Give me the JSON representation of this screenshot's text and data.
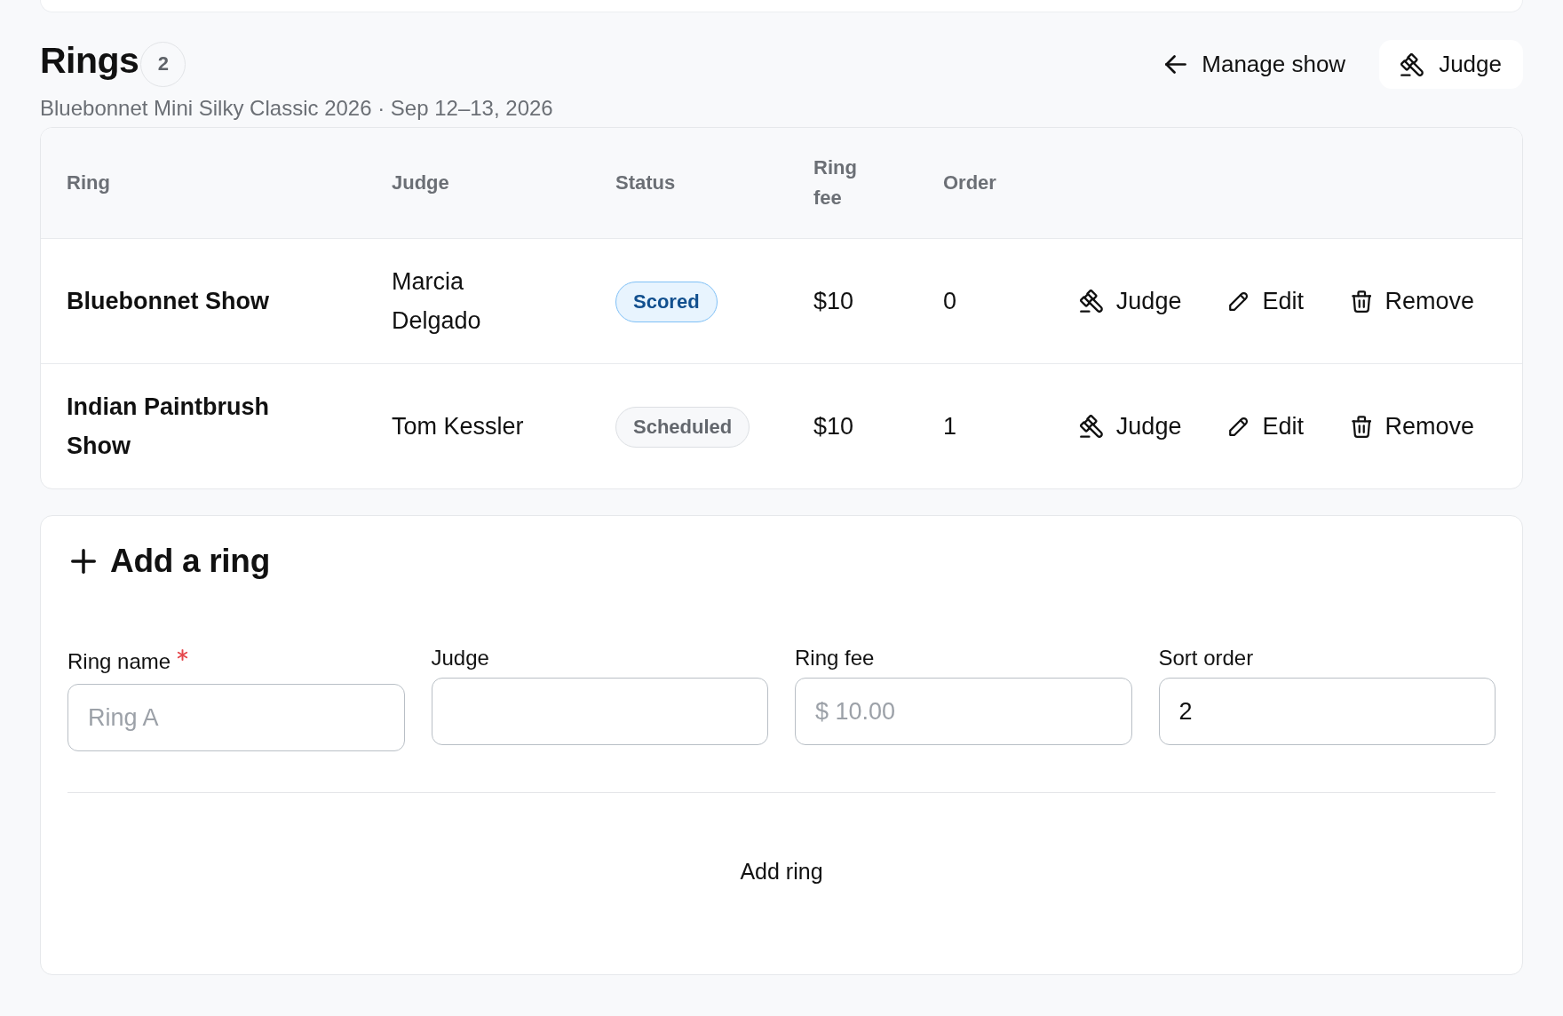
{
  "header": {
    "title": "Rings",
    "count": "2",
    "subtitle": "Bluebonnet Mini Silky Classic 2026 · Sep 12–13, 2026",
    "actions": [
      {
        "kind": "back",
        "label": "Manage show"
      },
      {
        "kind": "judge",
        "label": "Judge"
      }
    ]
  },
  "table": {
    "columns": [
      "Ring",
      "Judge",
      "Status",
      "Ring fee",
      "Order"
    ],
    "rows": [
      {
        "ring": "Bluebonnet Show",
        "judge": "Marcia Delgado",
        "status": {
          "kind": "scored",
          "label": "Scored"
        },
        "ring_fee": "$10",
        "order": "0",
        "actions": [
          {
            "kind": "judge",
            "label": "Judge"
          },
          {
            "kind": "edit",
            "label": "Edit"
          },
          {
            "kind": "remove",
            "label": "Remove"
          }
        ]
      },
      {
        "ring": "Indian Paintbrush Show",
        "judge": "Tom Kessler",
        "status": {
          "kind": "scheduled",
          "label": "Scheduled"
        },
        "ring_fee": "$10",
        "order": "1",
        "actions": [
          {
            "kind": "judge",
            "label": "Judge"
          },
          {
            "kind": "edit",
            "label": "Edit"
          },
          {
            "kind": "remove",
            "label": "Remove"
          }
        ]
      }
    ]
  },
  "add_ring": {
    "title": "Add a ring",
    "fields": [
      {
        "label": "Ring name",
        "required": true,
        "placeholder": "Ring A"
      },
      {
        "label": "Judge",
        "required": false
      },
      {
        "label": "Ring fee",
        "required": false,
        "placeholder": "$ 10.00"
      },
      {
        "label": "Sort order",
        "required": false,
        "value": "2"
      }
    ],
    "submit": "Add ring"
  }
}
